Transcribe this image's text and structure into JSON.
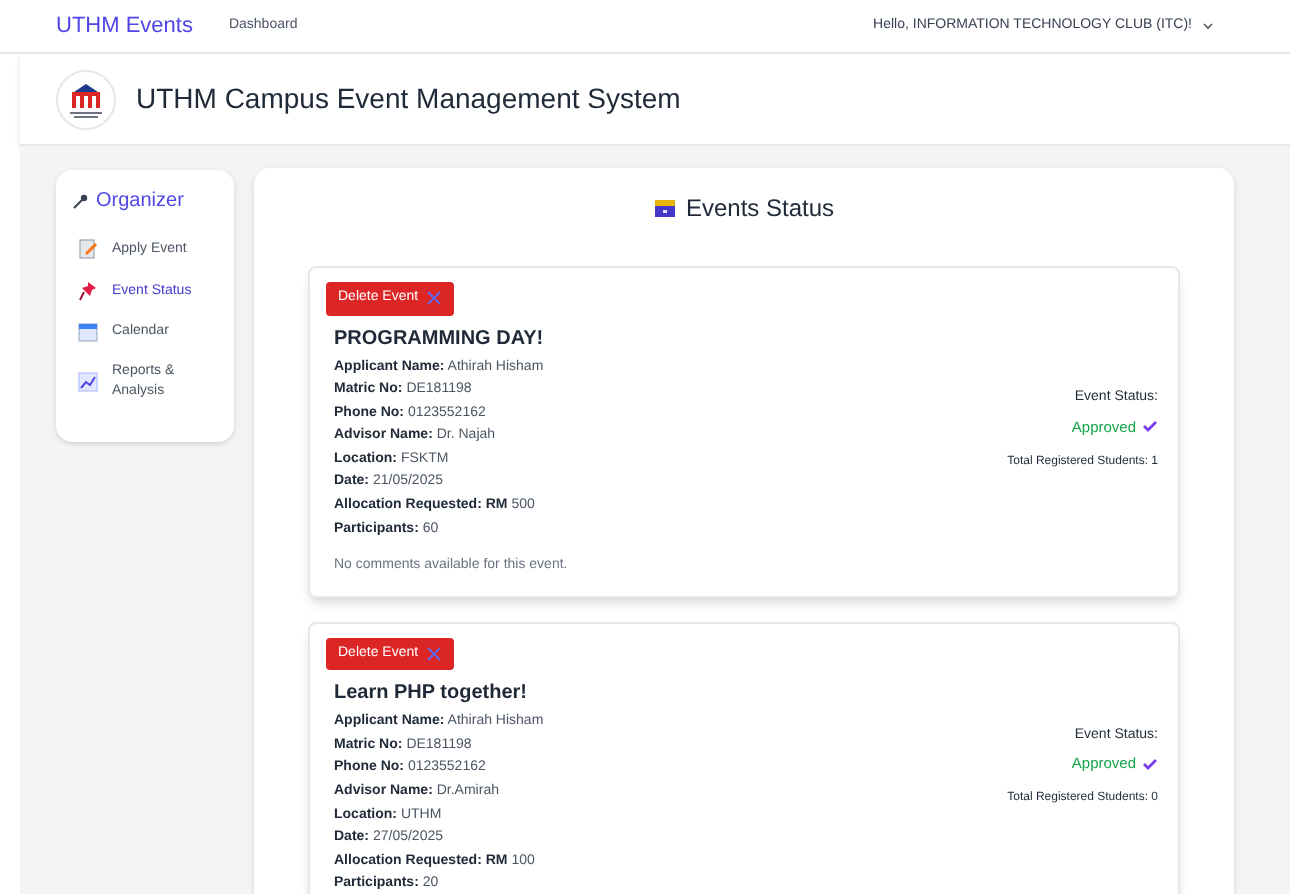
{
  "navbar": {
    "brand": "UTHM Events",
    "links": [
      "Dashboard"
    ],
    "user_menu": "Hello, INFORMATION TECHNOLOGY CLUB (ITC)!"
  },
  "header": {
    "title": "UTHM Campus Event Management System"
  },
  "sidebar": {
    "title": "Organizer",
    "items": [
      {
        "label": "Apply Event",
        "kind": "form",
        "selected": false
      },
      {
        "label": "Event Status",
        "kind": "pin",
        "selected": true
      },
      {
        "label": "Calendar",
        "kind": "calendar",
        "selected": false
      },
      {
        "label": "Reports & Analysis",
        "kind": "chart",
        "selected": false
      }
    ]
  },
  "page_title": "Events Status",
  "events": [
    {
      "delete_button": "Delete Event",
      "title": "PROGRAMMING DAY!",
      "fields": [
        {
          "label": "Applicant Name:",
          "value": "Athirah Hisham"
        },
        {
          "label": "Matric No:",
          "value": "DE181198"
        },
        {
          "label": "Phone No:",
          "value": "0123552162"
        },
        {
          "label": "Advisor Name:",
          "value": "Dr. Najah"
        },
        {
          "label": "Location:",
          "value": "FSKTM"
        },
        {
          "label": "Date:",
          "value": "21/05/2025"
        },
        {
          "label": "Allocation Requested: RM",
          "value": "500"
        },
        {
          "label": "Participants:",
          "value": "60"
        }
      ],
      "comments": "No comments available for this event.",
      "status_label": "Event Status:",
      "status": "Approved",
      "approved": true,
      "registered": "Total Registered Students: 1"
    },
    {
      "delete_button": "Delete Event",
      "title": "Learn PHP together!",
      "fields": [
        {
          "label": "Applicant Name:",
          "value": "Athirah Hisham"
        },
        {
          "label": "Matric No:",
          "value": "DE181198"
        },
        {
          "label": "Phone No:",
          "value": "0123552162"
        },
        {
          "label": "Advisor Name:",
          "value": "Dr.Amirah"
        },
        {
          "label": "Location:",
          "value": "UTHM"
        },
        {
          "label": "Date:",
          "value": "27/05/2025"
        },
        {
          "label": "Allocation Requested: RM",
          "value": "100"
        },
        {
          "label": "Participants:",
          "value": "20"
        }
      ],
      "status_label": "Event Status:",
      "status": "Approved",
      "approved": true,
      "registered": "Total Registered Students: 0"
    }
  ]
}
